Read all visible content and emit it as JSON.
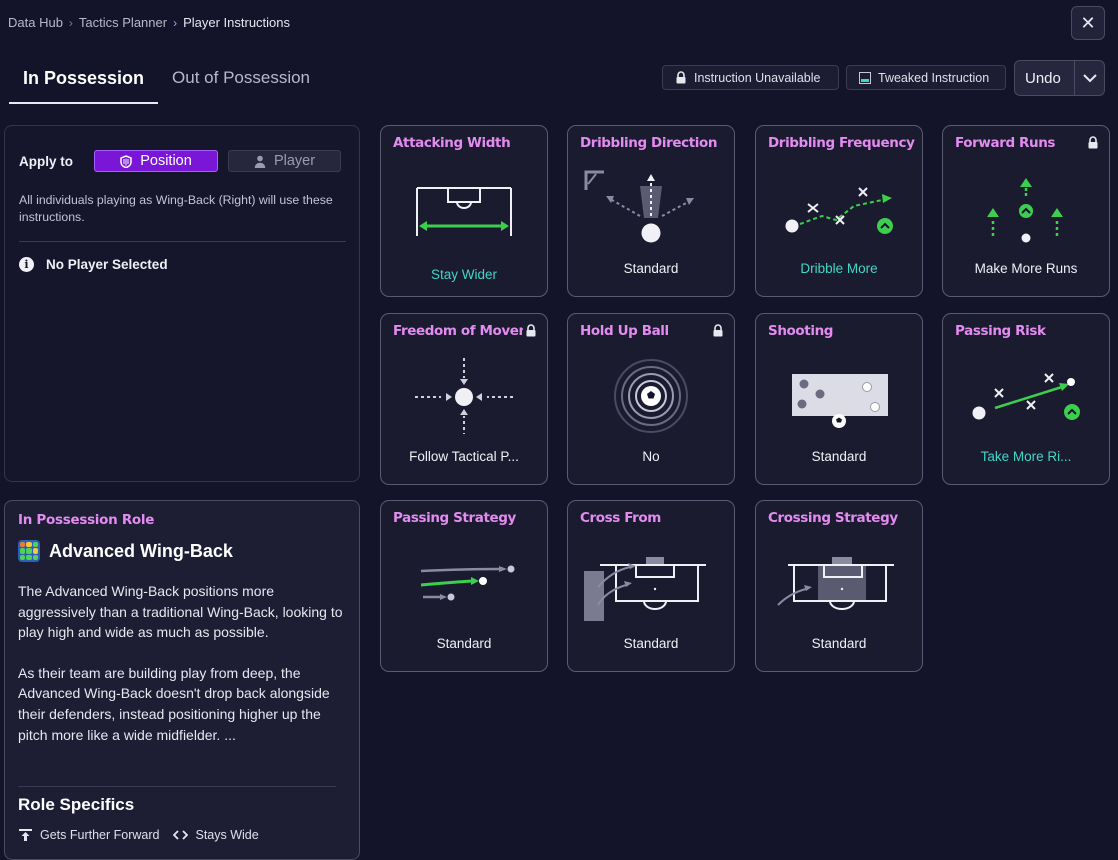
{
  "breadcrumb": [
    "Data Hub",
    "Tactics Planner",
    "Player Instructions"
  ],
  "tabs": [
    {
      "label": "In Possession",
      "active": true
    },
    {
      "label": "Out of Possession",
      "active": false
    }
  ],
  "legend": {
    "unavailable": "Instruction Unavailable",
    "tweaked": "Tweaked Instruction"
  },
  "undo_label": "Undo",
  "apply": {
    "label": "Apply to",
    "options": [
      {
        "label": "Position",
        "selected": true
      },
      {
        "label": "Player",
        "selected": false
      }
    ],
    "description": "All individuals playing as Wing-Back (Right) will use these instructions.",
    "no_player": "No Player Selected"
  },
  "role": {
    "heading": "In Possession Role",
    "name": "Advanced Wing-Back",
    "description": [
      "The Advanced Wing-Back positions more aggressively than a traditional Wing-Back, looking to play high and wide as much as possible.",
      "As their team are building play from deep, the Advanced Wing-Back doesn't drop back alongside their defenders, instead positioning higher up the pitch more like a wide midfielder. ..."
    ],
    "specifics_title": "Role Specifics",
    "specifics": [
      "Gets Further Forward",
      "Stays Wide"
    ]
  },
  "instructions": [
    {
      "title": "Attacking Width",
      "value": "Stay Wider",
      "tweaked": true,
      "locked": false
    },
    {
      "title": "Dribbling Direction",
      "value": "Standard",
      "tweaked": false,
      "locked": false
    },
    {
      "title": "Dribbling Frequency",
      "value": "Dribble More",
      "tweaked": true,
      "locked": false
    },
    {
      "title": "Forward Runs",
      "value": "Make More Runs",
      "tweaked": false,
      "locked": true
    },
    {
      "title": "Freedom of Movement",
      "value": "Follow Tactical P...",
      "tweaked": false,
      "locked": true
    },
    {
      "title": "Hold Up Ball",
      "value": "No",
      "tweaked": false,
      "locked": true
    },
    {
      "title": "Shooting",
      "value": "Standard",
      "tweaked": false,
      "locked": false
    },
    {
      "title": "Passing Risk",
      "value": "Take More Ri...",
      "tweaked": true,
      "locked": false
    },
    {
      "title": "Passing Strategy",
      "value": "Standard",
      "tweaked": false,
      "locked": false
    },
    {
      "title": "Cross From",
      "value": "Standard",
      "tweaked": false,
      "locked": false
    },
    {
      "title": "Crossing Strategy",
      "value": "Standard",
      "tweaked": false,
      "locked": false
    }
  ],
  "colors": {
    "accent": "#e38cf0",
    "tweaked": "#3fd6c6",
    "positive": "#3ccf4e",
    "selected": "#7a17d6"
  }
}
